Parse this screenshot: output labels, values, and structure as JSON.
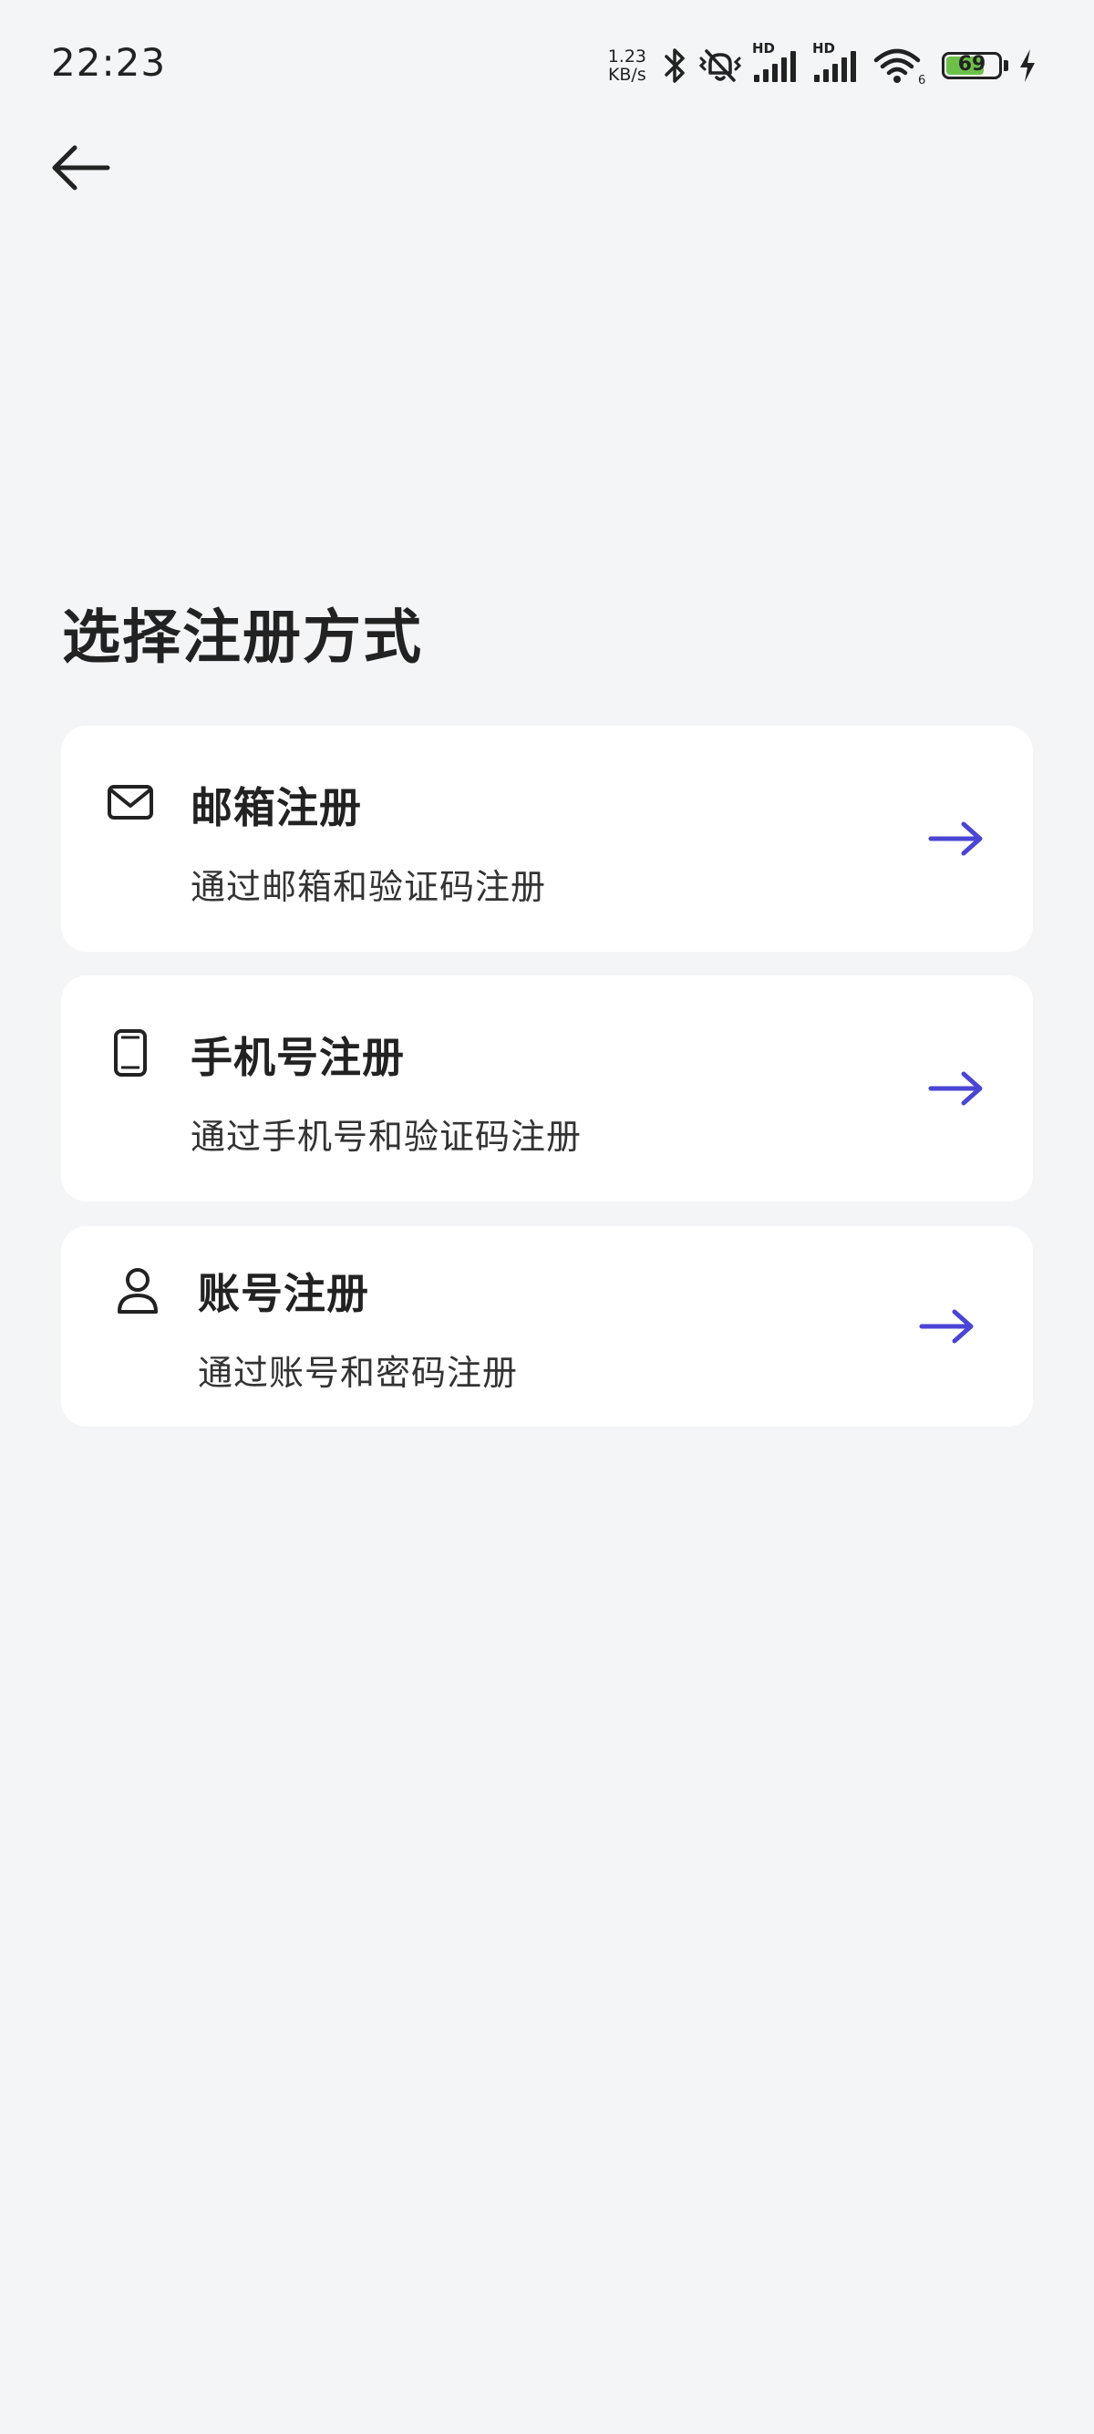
{
  "status_bar": {
    "time": "22:23",
    "net_speed_value": "1.23",
    "net_speed_unit": "KB/s",
    "signal1_label": "HD",
    "signal2_label": "HD",
    "wifi_badge": "6",
    "battery_level": "69",
    "icons": [
      "bluetooth-icon",
      "mute-vibrate-icon",
      "signal-icon",
      "signal-icon",
      "wifi-icon",
      "battery-icon",
      "charging-icon"
    ]
  },
  "header": {
    "back_icon": "arrow-left-icon"
  },
  "main": {
    "title": "选择注册方式",
    "options": [
      {
        "icon": "mail-icon",
        "title": "邮箱注册",
        "subtitle": "通过邮箱和验证码注册"
      },
      {
        "icon": "smartphone-icon",
        "title": "手机号注册",
        "subtitle": "通过手机号和验证码注册"
      },
      {
        "icon": "user-icon",
        "title": "账号注册",
        "subtitle": "通过账号和密码注册"
      }
    ]
  },
  "colors": {
    "background": "#f4f5f7",
    "card": "#ffffff",
    "accent_arrow": "#4a45d4",
    "text_primary": "#222222",
    "battery_fill": "#6cc04a"
  }
}
